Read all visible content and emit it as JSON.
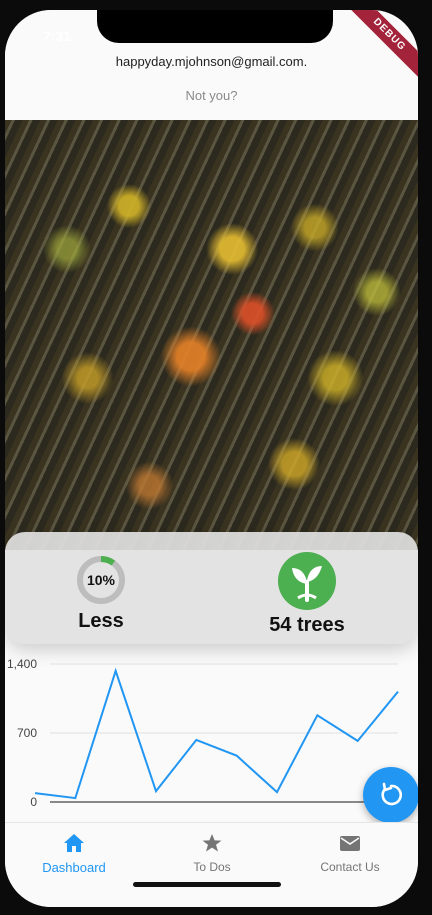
{
  "status_bar": {
    "time": "7:31",
    "debug_label": "DEBUG"
  },
  "header": {
    "email": "happyday.mjohnson@gmail.com.",
    "not_you": "Not you?"
  },
  "stats": {
    "progress": {
      "percent_label": "10%",
      "value": 0.1,
      "label": "Less"
    },
    "trees": {
      "label": "54 trees"
    }
  },
  "chart_data": {
    "type": "line",
    "y_ticks": [
      "1,400",
      "700",
      "0"
    ],
    "ylim": [
      0,
      1400
    ],
    "values": [
      90,
      40,
      1330,
      110,
      630,
      470,
      100,
      880,
      620,
      1120
    ],
    "color": "#2196f3"
  },
  "nav": {
    "items": [
      {
        "label": "Dashboard",
        "icon": "home-icon",
        "active": true
      },
      {
        "label": "To Dos",
        "icon": "star-icon",
        "active": false
      },
      {
        "label": "Contact Us",
        "icon": "mail-icon",
        "active": false
      }
    ]
  },
  "colors": {
    "accent": "#2196f3",
    "green": "#4caf50",
    "debug": "#a3233a"
  }
}
